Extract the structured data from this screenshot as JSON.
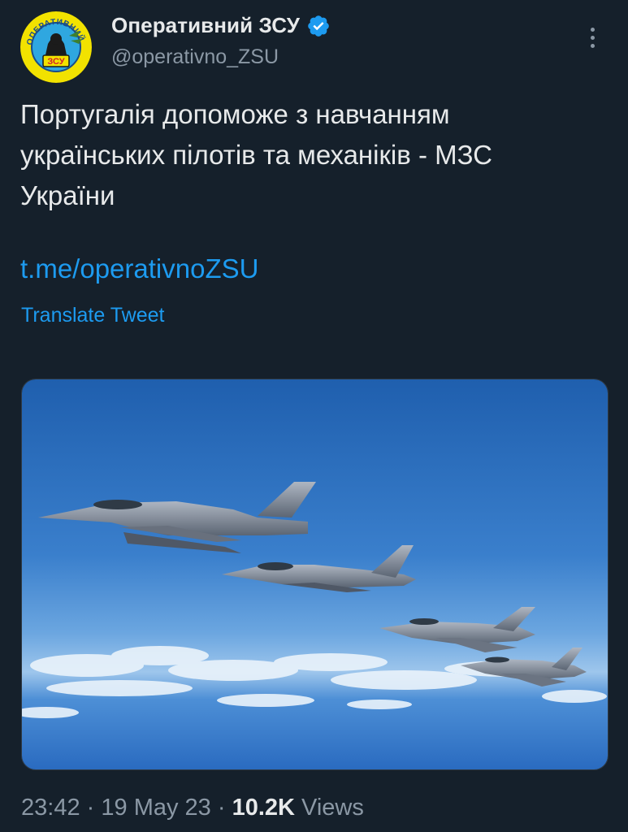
{
  "author": {
    "display_name": "Оперативний ЗСУ",
    "handle": "@operativno_ZSU",
    "avatar_text_top": "ОПЕРАТИВНИЙ",
    "avatar_text_badge": "ЗСУ"
  },
  "tweet": {
    "text": "Португалія допоможе з навчанням\nукраїнських пілотів та механіків - МЗС\nУкраїни",
    "link": "t.me/operativnoZSU",
    "translate_label": "Translate Tweet",
    "time": "23:42",
    "date": "19 May 23",
    "views_count": "10.2K",
    "views_label": "Views",
    "separator": "·"
  },
  "icons": {
    "verified": "verified-badge-icon",
    "more": "more-options-icon"
  },
  "colors": {
    "background": "#15202b",
    "accent": "#1d9bf0",
    "muted": "#8b98a5",
    "text": "#e7e9ea"
  }
}
